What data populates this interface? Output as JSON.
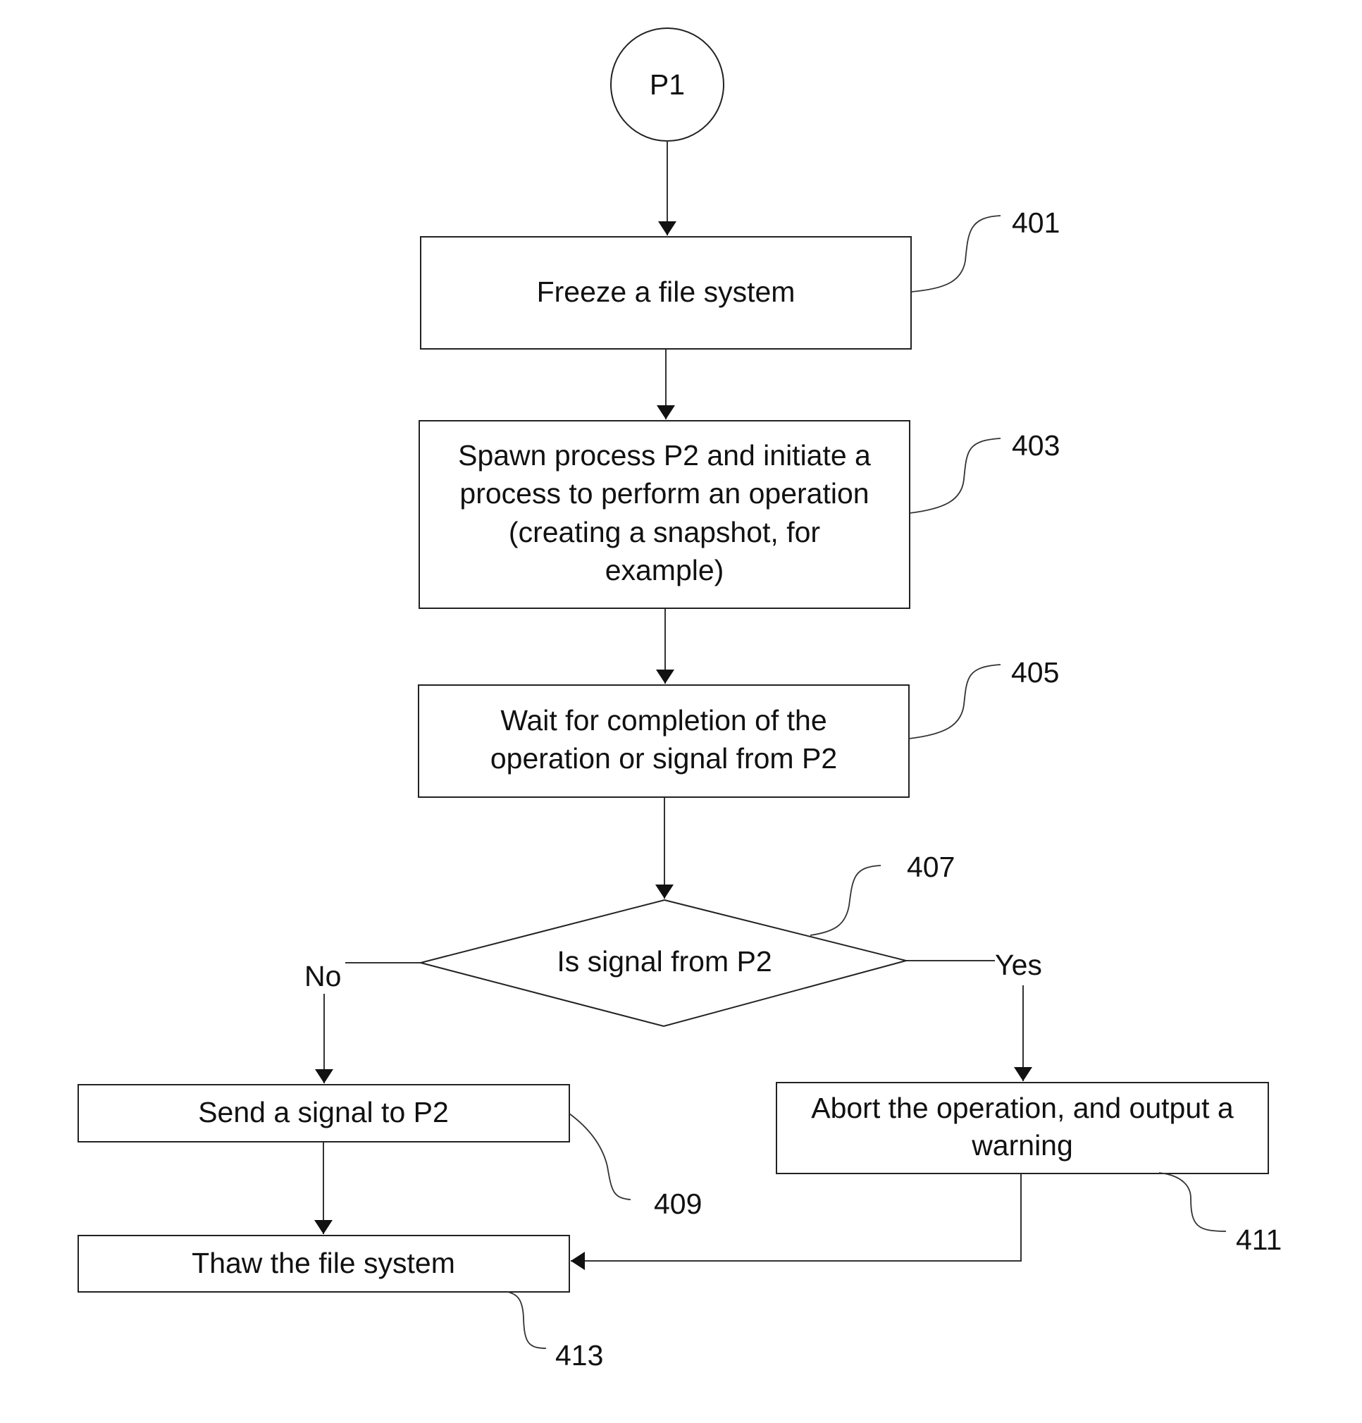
{
  "diagram": {
    "type": "flowchart",
    "start": {
      "id": "P1",
      "label": "P1"
    },
    "steps": [
      {
        "ref": "401",
        "lines": [
          "Freeze a file system"
        ]
      },
      {
        "ref": "403",
        "lines": [
          "Spawn process P2 and initiate a",
          "process to perform an operation",
          "(creating a snapshot, for",
          "example)"
        ]
      },
      {
        "ref": "405",
        "lines": [
          "Wait for completion of the",
          "operation or signal from P2"
        ]
      },
      {
        "ref": "407",
        "lines": [
          "Is signal from P2"
        ],
        "kind": "decision"
      },
      {
        "ref": "409",
        "lines": [
          "Send a signal to P2"
        ]
      },
      {
        "ref": "411",
        "lines": [
          "Abort the operation, and output a",
          "warning"
        ]
      },
      {
        "ref": "413",
        "lines": [
          "Thaw the file system"
        ]
      }
    ],
    "branches": {
      "no": "No",
      "yes": "Yes"
    },
    "edges": [
      {
        "from": "P1",
        "to": "401"
      },
      {
        "from": "401",
        "to": "403"
      },
      {
        "from": "403",
        "to": "405"
      },
      {
        "from": "405",
        "to": "407"
      },
      {
        "from": "407",
        "to": "409",
        "label": "No"
      },
      {
        "from": "407",
        "to": "411",
        "label": "Yes"
      },
      {
        "from": "409",
        "to": "413"
      },
      {
        "from": "411",
        "to": "413"
      }
    ]
  }
}
